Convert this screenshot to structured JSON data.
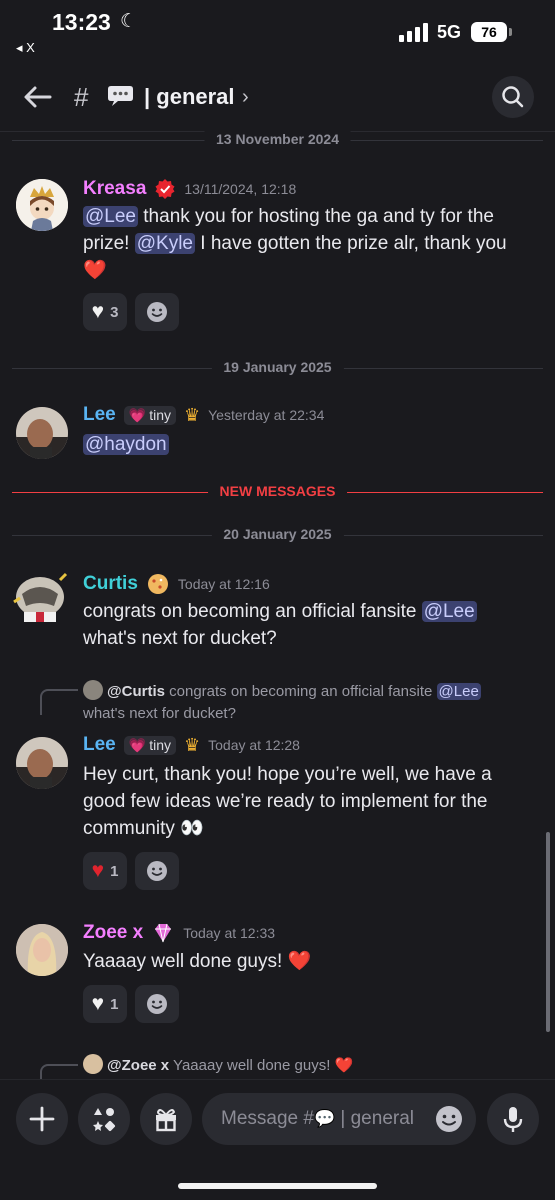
{
  "status_bar": {
    "time": "13:23",
    "back_app": "◂ X",
    "network": "5G",
    "battery": "76"
  },
  "header": {
    "hash": "#",
    "channel_name": "| general",
    "chevron": "›"
  },
  "dividers": {
    "d1": "13 November 2024",
    "d2": "19 January 2025",
    "new": "NEW MESSAGES",
    "d3": "20 January 2025"
  },
  "messages": [
    {
      "author": "Kreasa",
      "author_color": "#f47fff",
      "timestamp": "13/11/2024, 12:18",
      "mention1": "@Lee",
      "text1": " thank you for hosting the ga and ty for the prize! ",
      "mention2": "@Kyle",
      "text2": " I have gotten the prize alr, thank you ",
      "reaction_count": "3"
    },
    {
      "author": "Lee",
      "author_color": "#5ab4f2",
      "role": "tiny",
      "timestamp": "Yesterday at 22:34",
      "mention1": "@haydon"
    },
    {
      "author": "Curtis",
      "author_color": "#40d0d8",
      "timestamp": "Today at 12:16",
      "text1": "congrats on becoming an official fansite ",
      "mention1": "@Lee",
      "text2": " what's next for ducket?"
    },
    {
      "reply_author": "@Curtis",
      "reply_text1": " congrats on becoming an official fansite ",
      "reply_mention": "@Lee",
      "reply_text2": " what's next for ducket?",
      "author": "Lee",
      "author_color": "#5ab4f2",
      "role": "tiny",
      "timestamp": "Today at 12:28",
      "text1": "Hey curt, thank you! hope you’re well, we have a good few ideas we’re ready to implement for the community ",
      "reaction_count": "1"
    },
    {
      "author": "Zoee x",
      "author_color": "#f47fff",
      "timestamp": "Today at 12:33",
      "text1": "Yaaaay well done guys! ",
      "reaction_count": "1"
    },
    {
      "reply_author": "@Zoee x",
      "reply_text1": " Yaaaay well done guys! "
    }
  ],
  "composer": {
    "placeholder_prefix": "Message #",
    "placeholder_suffix": " | general"
  },
  "icons": {
    "status": [
      "moon-icon",
      "signal-icon",
      "battery-icon"
    ],
    "header": [
      "back-arrow-icon",
      "speech-bubble-icon",
      "search-icon"
    ],
    "composer": [
      "plus-icon",
      "apps-icon",
      "gift-icon",
      "emoji-icon",
      "microphone-icon"
    ]
  },
  "colors": {
    "mention_bg": "#3c4270",
    "new_messages": "#f23f43",
    "background": "#1a1a1e"
  }
}
